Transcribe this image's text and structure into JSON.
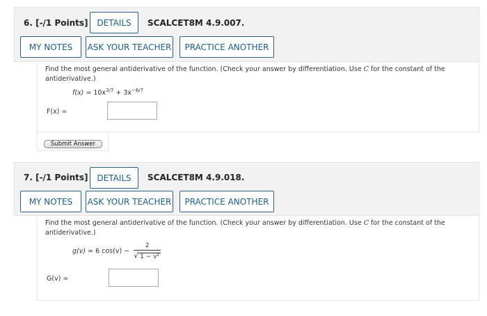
{
  "questions": [
    {
      "number_points": "6. [-/1 Points]",
      "details_label": "DETAILS",
      "code": "SCALCET8M 4.9.007.",
      "my_notes_label": "MY NOTES",
      "ask_teacher_label": "ASK YOUR TEACHER",
      "practice_another_label": "PRACTICE ANOTHER",
      "prompt_before_c": "Find the most general antiderivative of the function. (Check your answer by differentiation. Use ",
      "prompt_c": "C",
      "prompt_after_c": " for the constant of the antiderivative.)",
      "formula_lhs": "f(x)",
      "formula_eq": " = 10x",
      "formula_exp1": "3/7",
      "formula_mid": " + 3x",
      "formula_exp2": "−6/7",
      "answer_label": "F(x) =",
      "answer_value": "",
      "submit_label": "Submit Answer"
    },
    {
      "number_points": "7. [-/1 Points]",
      "details_label": "DETAILS",
      "code": "SCALCET8M 4.9.018.",
      "my_notes_label": "MY NOTES",
      "ask_teacher_label": "ASK YOUR TEACHER",
      "practice_another_label": "PRACTICE ANOTHER",
      "prompt_before_c": "Find the most general antiderivative of the function. (Check your answer by differentiation. Use ",
      "prompt_c": "C",
      "prompt_after_c": " for the constant of the antiderivative.)",
      "formula_lhs": "g(v)",
      "formula_eq": " = 6 cos(v) − ",
      "frac_num": "2",
      "sqrt_symbol": "√",
      "frac_den": "1 − v²",
      "answer_label": "G(v) =",
      "answer_value": ""
    }
  ],
  "colors": {
    "button_text": "#1d5e86",
    "button_border": "#2a6286",
    "header_bg": "#f2f2f2"
  }
}
